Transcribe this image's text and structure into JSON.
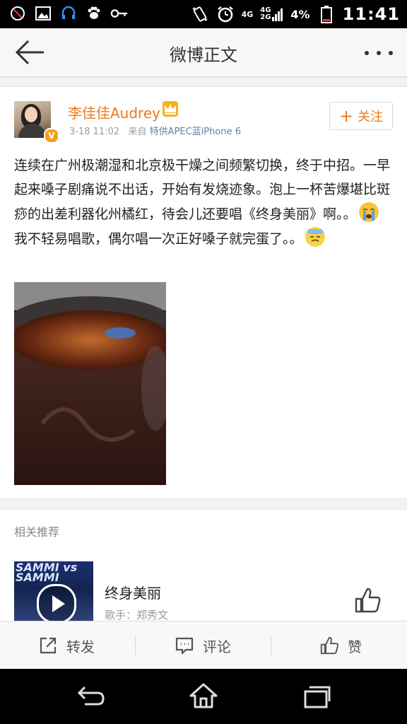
{
  "status_bar": {
    "network": "4G",
    "network2": "4G\n2G",
    "battery": "4%",
    "time": "11:41",
    "icons": [
      "no-disturb-icon",
      "image-icon",
      "headset-icon",
      "paw-icon",
      "key-icon",
      "vibrate-icon",
      "alarm-icon",
      "signal-icon",
      "battery-icon"
    ]
  },
  "titlebar": {
    "title": "微博正文"
  },
  "post": {
    "username": "李佳佳Audrey",
    "time": "3-18 11:02",
    "source_prefix": "来自",
    "source": "特供APEC蓝iPhone 6",
    "follow_label": "关注",
    "text_part1": "连续在广州极潮湿和北京极干燥之间频繁切换，终于中招。一早起来嗓子剧痛说不出话，开始有发烧迹象。泡上一杯苦爆堪比斑痧的出差利器化州橘红，待会儿还要唱《终身美丽》啊。。",
    "text_part2": "我不轻易唱歌，偶尔唱一次正好嗓子就完蛋了。。",
    "emoji1": "crying-emoji",
    "emoji2": "sweat-emoji"
  },
  "recommend": {
    "header": "相关推荐",
    "song_title": "终身美丽",
    "artist_line": "歌手：郑秀文",
    "thumb_text": "SAMMI vs SAMMI"
  },
  "actions": {
    "repost": "转发",
    "comment": "评论",
    "like": "赞"
  },
  "colors": {
    "accent": "#ea7a1c",
    "link": "#5d7fa6"
  }
}
